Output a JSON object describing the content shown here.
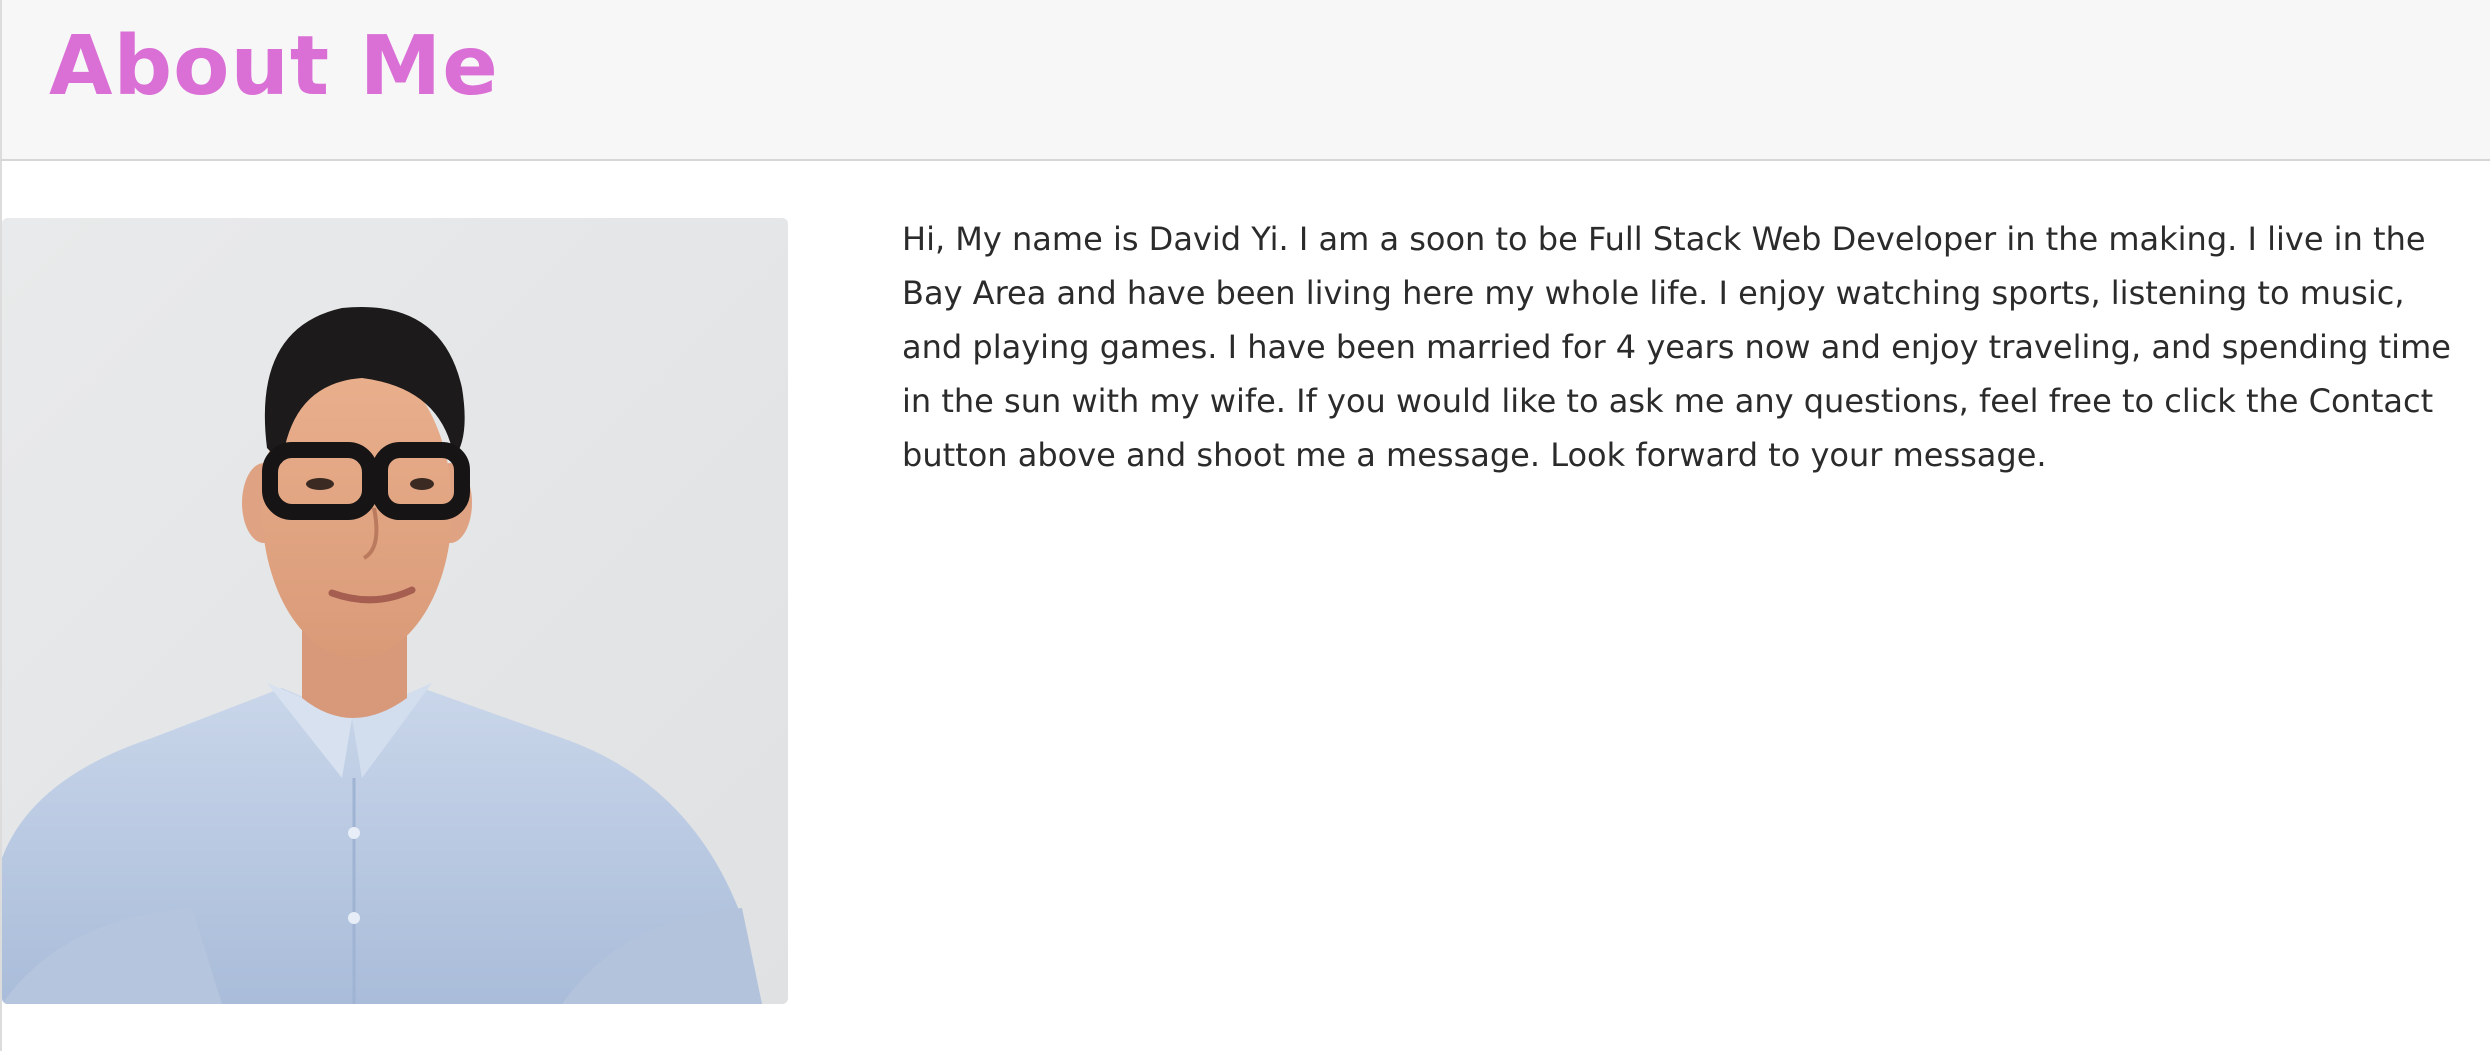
{
  "header": {
    "title": "About Me",
    "title_color": "#da70d6"
  },
  "profile": {
    "photo_icon": "portrait-photo-icon"
  },
  "about": {
    "text": "Hi, My name is David Yi. I am a soon to be Full Stack Web Developer in the making. I live in the Bay Area and have been living here my whole life. I enjoy watching sports, listening to music, and playing games. I have been married for 4 years now and enjoy traveling, and spending time in the sun with my wife. If you would like to ask me any questions, feel free to click the Contact button above and shoot me a message. Look forward to your message."
  }
}
